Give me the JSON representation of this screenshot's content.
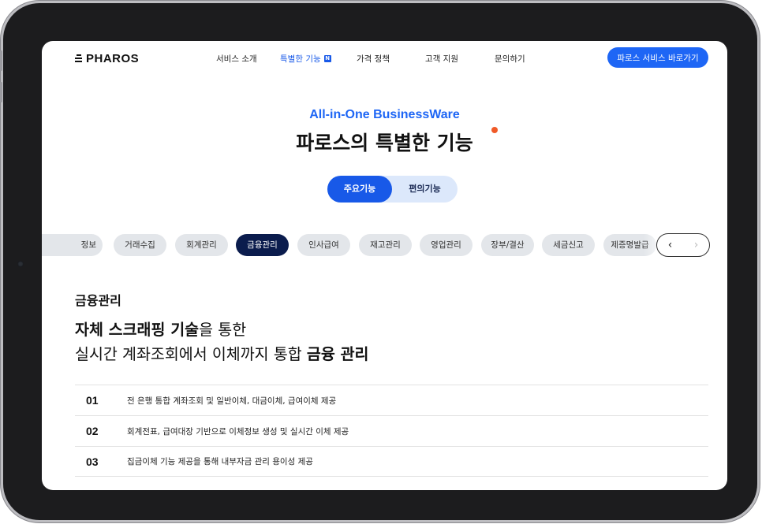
{
  "header": {
    "logo_text": "PHAROS",
    "nav": [
      {
        "label": "서비스 소개"
      },
      {
        "label": "특별한 기능",
        "badge": "N"
      },
      {
        "label": "가격 정책"
      },
      {
        "label": "고객 지원"
      },
      {
        "label": "문의하기"
      }
    ],
    "cta_label": "파로스 서비스 바로가기"
  },
  "hero": {
    "subtitle": "All-in-One BusinessWare",
    "title": "파로스의 특별한 기능"
  },
  "toggle": {
    "primary": "주요기능",
    "secondary": "편의기능"
  },
  "categories": [
    "정보",
    "거래수집",
    "회계관리",
    "금융관리",
    "인사급여",
    "재고관리",
    "영업관리",
    "장부/결산",
    "세금신고",
    "제증명발급"
  ],
  "active_category": "금융관리",
  "carousel": {
    "prev": "‹",
    "next": "›"
  },
  "content": {
    "section_title": "금융관리",
    "headline_line1_bold": "자체 스크래핑 기술",
    "headline_line1_rest": "을 통한",
    "headline_line2_rest": "실시간 계좌조회에서 이체까지 통합 ",
    "headline_line2_bold": "금융 관리",
    "features": [
      {
        "num": "01",
        "text": "전 은행 통합 계좌조회 및 일반이체, 대금이체, 급여이체 제공"
      },
      {
        "num": "02",
        "text": "회계전표, 급여대장 기반으로 이체정보 생성 및 실시간 이체 제공"
      },
      {
        "num": "03",
        "text": "집금이체 기능 제공을 통해 내부자금 관리 용이성 제공"
      }
    ]
  },
  "colors": {
    "accent": "#1E66F5",
    "active_chip": "#0B1C4D",
    "dot": "#F05A28"
  }
}
